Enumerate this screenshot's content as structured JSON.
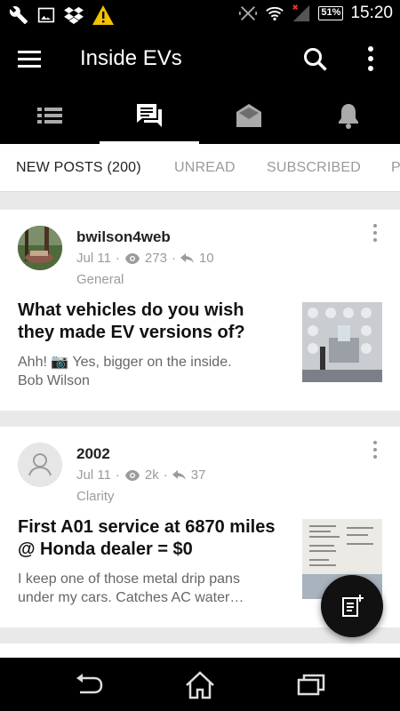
{
  "status_bar": {
    "time": "15:20",
    "battery": "51%",
    "icons": [
      "wrench-icon",
      "image-icon",
      "dropbox-icon",
      "warning-icon",
      "vibrate-icon",
      "wifi-icon",
      "signal-icon"
    ]
  },
  "app_bar": {
    "title": "Inside EVs",
    "menu_icon": "menu-icon",
    "search_icon": "search-icon",
    "more_icon": "more-vert-icon"
  },
  "icon_tabs": [
    {
      "icon": "list-icon",
      "active": false
    },
    {
      "icon": "chat-icon",
      "active": true
    },
    {
      "icon": "mail-open-icon",
      "active": false
    },
    {
      "icon": "bell-icon",
      "active": false
    }
  ],
  "text_tabs": [
    {
      "label": "NEW POSTS (200)",
      "active": true
    },
    {
      "label": "UNREAD",
      "active": false
    },
    {
      "label": "SUBSCRIBED",
      "active": false
    },
    {
      "label": "P",
      "active": false
    }
  ],
  "posts": [
    {
      "username": "bwilson4web",
      "date": "Jul 11",
      "views": "273",
      "replies": "10",
      "category": "General",
      "title": "What vehicles do you wish they made EV versions of?",
      "excerpt_line1": "Ahh! 📷 Yes, bigger on the inside.",
      "excerpt_line2": "Bob Wilson"
    },
    {
      "username": "2002",
      "date": "Jul 11",
      "views": "2k",
      "replies": "37",
      "category": "Clarity",
      "title": "First A01 service at 6870 miles @ Honda dealer = $0",
      "excerpt_line1": "I keep one of those metal drip pans",
      "excerpt_line2": "under my cars. Catches AC water…"
    }
  ],
  "fab": {
    "icon": "new-post-icon"
  },
  "nav_bar": {
    "icons": [
      "back-icon",
      "home-icon",
      "recents-icon"
    ]
  },
  "colors": {
    "bar": "#000000",
    "background": "#e9e9e9",
    "muted": "#9b9b9b",
    "title": "#111111"
  }
}
